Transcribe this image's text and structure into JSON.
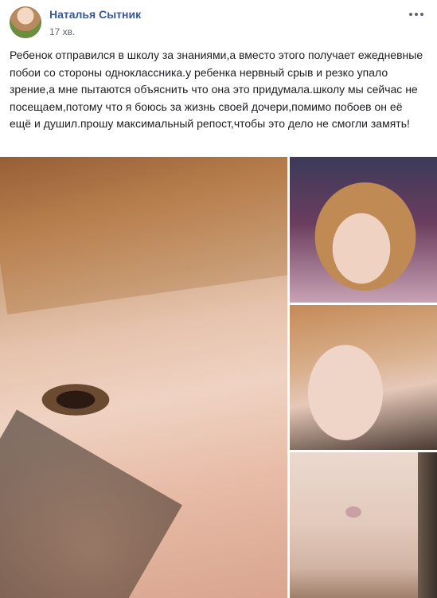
{
  "post": {
    "author": "Наталья Сытник",
    "timestamp": "17 хв.",
    "text": "Ребенок отправился в школу за знаниями,а вместо этого получает ежедневные побои со стороны одноклассника.у ребенка нервный срыв и резко упало зрение,а мне пытаются объяснить что она это придумала.школу мы сейчас не посещаем,потому что я боюсь за жизнь своей дочери,помимо побоев он её ещё и душил.прошу максимальный репост,чтобы это дело не смогли замять!"
  },
  "icons": {
    "more": "more-horizontal-icon"
  },
  "colors": {
    "author_link": "#385898",
    "timestamp": "#616770",
    "body_text": "#1c1e21",
    "background": "#ffffff"
  },
  "photos": {
    "count": 4
  }
}
